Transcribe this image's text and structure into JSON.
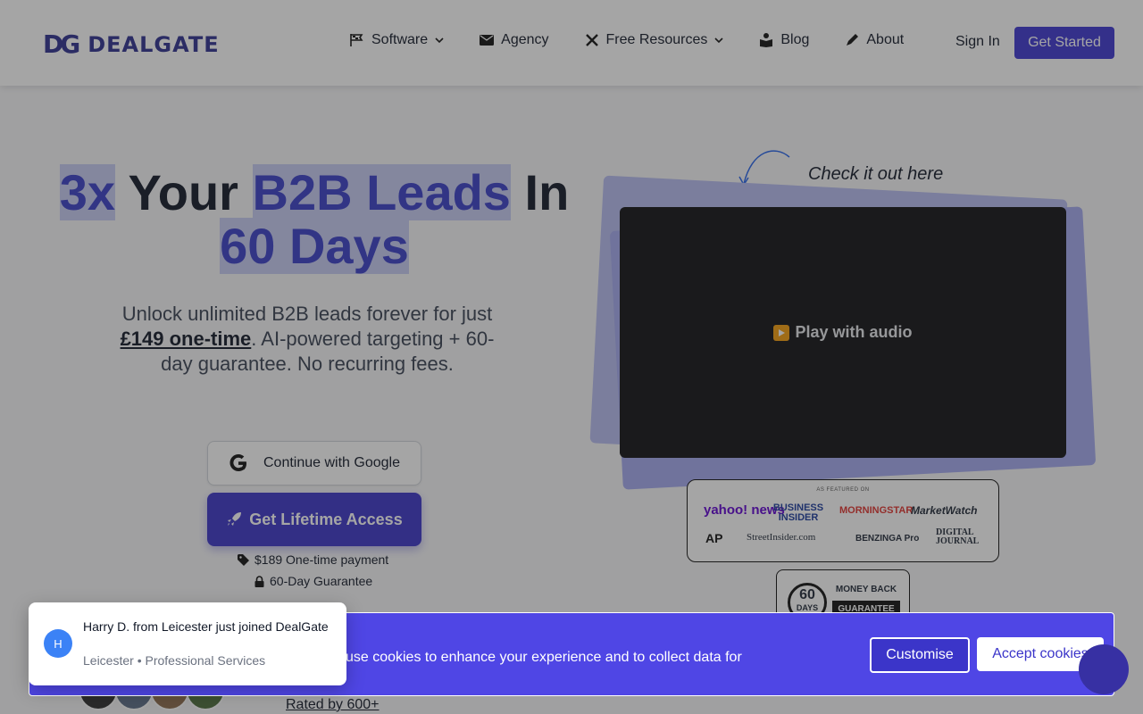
{
  "brand": {
    "mark": "DG",
    "name": "DEALGATE",
    "color": "#2d2f8f"
  },
  "nav": {
    "items": [
      {
        "label": "Software",
        "icon": "flag-icon",
        "dropdown": true
      },
      {
        "label": "Agency",
        "icon": "envelope-icon",
        "dropdown": false
      },
      {
        "label": "Free Resources",
        "icon": "tools-icon",
        "dropdown": true
      },
      {
        "label": "Blog",
        "icon": "book-reader-icon",
        "dropdown": false
      },
      {
        "label": "About",
        "icon": "pen-icon",
        "dropdown": false
      }
    ],
    "sign_in": "Sign In",
    "get_started": "Get Started"
  },
  "hero": {
    "title_part1": "3x",
    "title_part2": " Your ",
    "title_part3": "B2B Leads",
    "title_part4": " In",
    "title_part5": "60 Days",
    "sub_before": "Unlock unlimited B2B leads forever for just ",
    "sub_price": "£149 one-time",
    "sub_after": ". AI-powered targeting + 60-day guarantee. No recurring fees.",
    "google_button": "Continue with Google",
    "cta_button": "Get Lifetime Access",
    "payment_note": "$189 One-time payment",
    "guarantee_note": "60-Day Guarantee",
    "rated": "Rated by 600+"
  },
  "video": {
    "callout": "Check it out here",
    "play_label": "Play with audio"
  },
  "featured": {
    "heading": "AS FEATURED ON",
    "logos": [
      "yahoo! news",
      "BUSINESS INSIDER",
      "MORNINGSTAR",
      "MarketWatch",
      "AP",
      "StreetInsider.com",
      "BENZINGA Pro",
      "DIGITAL JOURNAL"
    ]
  },
  "guarantee_badge": {
    "number": "60",
    "days": "DAYS",
    "line1": "MONEY BACK",
    "line2": "GUARANTEE"
  },
  "cookie": {
    "text": "es. We use cookies to enhance your experience and to collect data for",
    "customise": "Customise",
    "accept": "Accept cookies",
    "accent": "#4f46e5"
  },
  "toast": {
    "initial": "H",
    "message": "Harry D. from Leicester just joined DealGate",
    "meta": "Leicester • Professional Services"
  }
}
